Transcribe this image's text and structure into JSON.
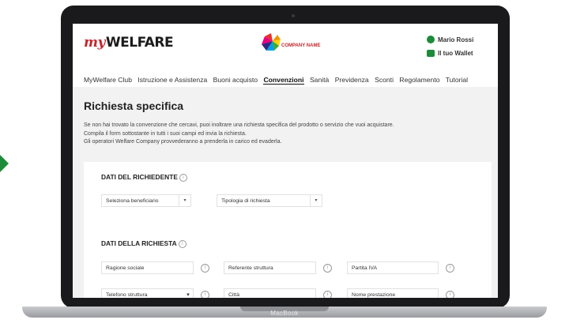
{
  "brand": {
    "logo_my": "my",
    "logo_rest": "WELFARE",
    "company_name": "COMPANY NAME"
  },
  "user": {
    "name": "Mario Rossi",
    "wallet": "Il tuo Wallet"
  },
  "nav": [
    "MyWelfare Club",
    "Istruzione e Assistenza",
    "Buoni acquisto",
    "Convenzioni",
    "Sanità",
    "Previdenza",
    "Sconti",
    "Regolamento",
    "Tutorial"
  ],
  "page": {
    "title": "Richiesta specifica",
    "intro": [
      "Se non hai trovato la convenzione che cercavi, puoi inoltrare una richiesta specifica del prodotto o servizio che vuoi acquistare.",
      "Compila il form sottostante in tutti i suoi campi ed invia la richiesta.",
      "Gli operatori Welfare Company provvederanno a prenderla in carico ed evaderla."
    ]
  },
  "section1": {
    "title": "DATI DEL RICHIEDENTE",
    "select_beneficiario": "Seleziona beneficiario",
    "select_tipologia": "Tipologia di richiesta"
  },
  "section2": {
    "title": "DATI DELLA RICHIESTA",
    "fields": [
      "Ragione sociale",
      "Referente struttura",
      "Partita IVA",
      "Telefono struttura",
      "Città",
      "Nome prestazione"
    ]
  },
  "icons": {
    "info": "i",
    "chevron": "▾"
  },
  "device": {
    "label": "MacBook"
  },
  "colors": {
    "accent": "#1e8b3a",
    "brand_red": "#c2272d"
  }
}
